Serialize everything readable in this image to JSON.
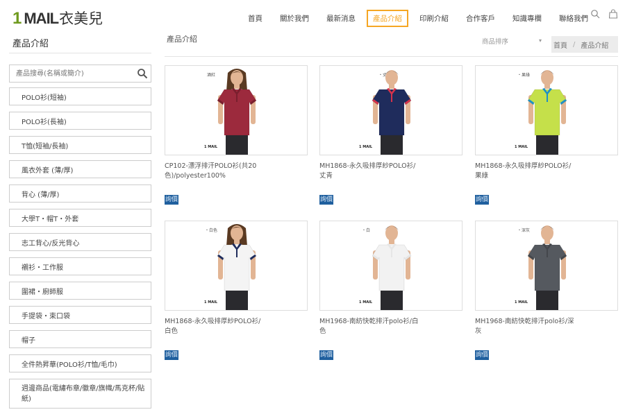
{
  "header": {
    "logo_one": "1",
    "logo_mail": "MAIL",
    "logo_cn": "衣美兒",
    "nav": [
      {
        "label": "首頁",
        "active": false
      },
      {
        "label": "關於我們",
        "active": false
      },
      {
        "label": "最新消息",
        "active": false
      },
      {
        "label": "產品介紹",
        "active": true
      },
      {
        "label": "印刷介紹",
        "active": false
      },
      {
        "label": "合作客戶",
        "active": false
      },
      {
        "label": "知識專欄",
        "active": false
      },
      {
        "label": "聯絡我們",
        "active": false
      }
    ],
    "icons": [
      "search-icon",
      "bag-icon"
    ],
    "accent_color": "#f5a623"
  },
  "sidebar": {
    "title": "產品介紹",
    "search_placeholder": "產品搜尋(名稱或簡介)",
    "categories": [
      "POLO衫(短袖)",
      "POLO衫(長袖)",
      "T恤(短袖/長袖)",
      "風衣外套 (薄/厚)",
      "背心 (薄/厚)",
      "大學T・帽T・外套",
      "志工背心/反光背心",
      "襯衫・工作服",
      "圍裙・廚師服",
      "手提袋・束口袋",
      "帽子",
      "全件熱昇華(POLO衫/T恤/毛巾)",
      "週邊商品(電繡布章/徽章/旗幟/馬克杯/貼紙)"
    ]
  },
  "main": {
    "title": "產品介紹",
    "sort_label": "商品排序",
    "breadcrumb": [
      "首頁",
      "產品介紹"
    ],
    "inquiry_label": "詢價",
    "inquiry_color": "#1f5f9e",
    "brand_tag": "1 MAIL",
    "products": [
      {
        "name": "CP102-漂浮排汗POLO衫(共20色)/polyester100%",
        "color_tag": "酒紅",
        "shirt_color": "#9c2a3d",
        "collar_color": "#7a1f2e",
        "gender": "female"
      },
      {
        "name": "MH1868-永久吸排厚紗POLO衫/丈青",
        "color_tag": "・丈青",
        "shirt_color": "#1f2c5c",
        "collar_color": "#d6324a",
        "gender": "male"
      },
      {
        "name": "MH1868-永久吸排厚紗POLO衫/果綠",
        "color_tag": "・果綠",
        "shirt_color": "#c5e04a",
        "collar_color": "#1e90c8",
        "gender": "male"
      },
      {
        "name": "MH1868-永久吸排厚紗POLO衫/白色",
        "color_tag": "・白色",
        "shirt_color": "#f4f4f4",
        "collar_color": "#1f2c5c",
        "gender": "female"
      },
      {
        "name": "MH1968-南紡快乾排汗polo衫/白色",
        "color_tag": "・白",
        "shirt_color": "#f2f2f2",
        "collar_color": "#e6e6e6",
        "gender": "male"
      },
      {
        "name": "MH1968-南紡快乾排汗polo衫/深灰",
        "color_tag": "・深灰",
        "shirt_color": "#55595f",
        "collar_color": "#44474c",
        "gender": "male"
      }
    ]
  }
}
